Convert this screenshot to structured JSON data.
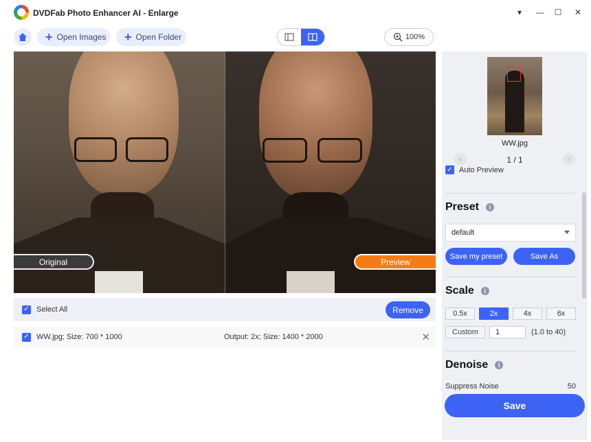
{
  "window": {
    "title": "DVDFab Photo Enhancer AI - Enlarge",
    "controls": [
      "▾",
      "—",
      "☐",
      "✕"
    ]
  },
  "toolbar": {
    "open_images": "Open Images",
    "open_folder": "Open Folder",
    "zoom": "100%"
  },
  "preview": {
    "left_label": "Original",
    "right_label": "Preview"
  },
  "file_list": {
    "select_all": "Select All",
    "remove": "Remove",
    "files": [
      {
        "name": "WW.jpg; Size: 700 * 1000",
        "output": "Output: 2x; Size: 1400 * 2000",
        "checked": true
      }
    ]
  },
  "panel": {
    "thumbnail_name": "WW.jpg",
    "page": "1 / 1",
    "auto_preview": "Auto Preview",
    "preset": {
      "title": "Preset",
      "selected": "default",
      "save_my_preset": "Save my preset",
      "save_as": "Save As"
    },
    "scale": {
      "title": "Scale",
      "options": [
        "0.5x",
        "2x",
        "4x",
        "6x"
      ],
      "selected": "2x",
      "custom_label": "Custom",
      "custom_value": "1",
      "range_note": "(1.0 to 40)"
    },
    "denoise": {
      "title": "Denoise",
      "suppress_noise_label": "Suppress Noise",
      "suppress_noise_value": "50"
    },
    "save": "Save"
  },
  "colors": {
    "accent": "#3d63f5",
    "preview_label": "#f57c14",
    "original_label": "#3b3b3b"
  }
}
